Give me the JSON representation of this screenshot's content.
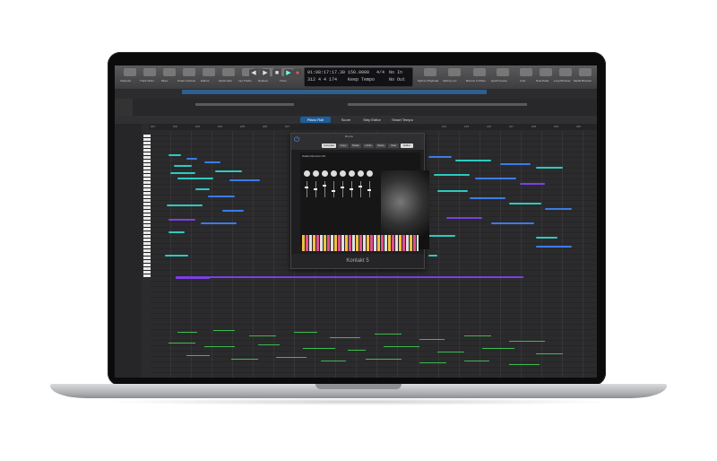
{
  "lcd": {
    "position": "01:08:17:17.30",
    "bars": "312 4 4 174",
    "tempo": "150.0000",
    "tempo_label": "Keep Tempo",
    "signature": "4/4",
    "key": "No In",
    "out": "No Out"
  },
  "toolbar": {
    "labels": [
      "Inspector",
      "Track Order",
      "Mixer",
      "Smart Controls",
      "Editors",
      "Quick Help",
      "Lay Tracks",
      "Replace",
      "Tuner",
      "Play",
      "Split by Playhead",
      "Split by Loc",
      "Bounce In Place",
      "Quick Freeze",
      "Lists",
      "Note Pads",
      "Loop Browser",
      "Media Browser"
    ]
  },
  "editor_tabs": [
    "Piano Roll",
    "Score",
    "Step Editor",
    "Smart Tempo"
  ],
  "ruler_numbers": [
    "201",
    "202",
    "203",
    "204",
    "205",
    "206",
    "207",
    "208",
    "209",
    "210",
    "211",
    "212",
    "213",
    "214",
    "215",
    "216",
    "217",
    "218",
    "219",
    "220"
  ],
  "plugin": {
    "title": "Drums",
    "tabs": [
      "Compare",
      "Copy",
      "Paste",
      "Undo",
      "Redo",
      "View",
      "Editor"
    ],
    "instrument": "Studio Drummer Kit",
    "footer": "Kontakt 5"
  },
  "colors": {
    "accent": "#1c5e9c",
    "note_teal": "#2ec9c0",
    "note_blue": "#3d7be6",
    "note_purple": "#7b3fe4",
    "note_green": "#3dbb4f"
  }
}
